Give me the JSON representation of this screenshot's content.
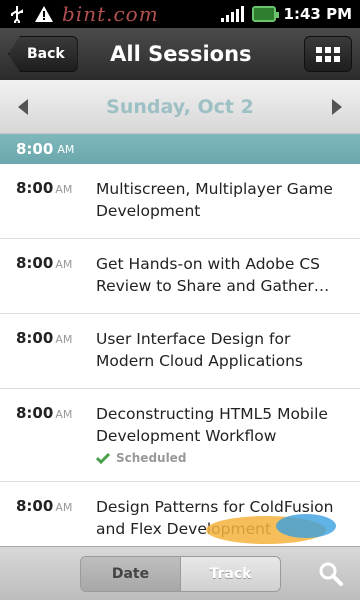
{
  "status_bar": {
    "watermark": "bint.com",
    "time": "1:43 PM",
    "icons": [
      "usb-icon",
      "warning-icon",
      "signal-icon",
      "battery-icon"
    ]
  },
  "header": {
    "back_label": "Back",
    "title": "All Sessions",
    "menu_icon": "grid-icon"
  },
  "date_nav": {
    "date": "Sunday, Oct 2",
    "prev_icon": "chevron-left-icon",
    "next_icon": "chevron-right-icon"
  },
  "section": {
    "time": "8:00",
    "ampm": "AM"
  },
  "sessions": [
    {
      "time": "8:00",
      "ampm": "AM",
      "title": "Multiscreen, Multiplayer Game Development",
      "status": ""
    },
    {
      "time": "8:00",
      "ampm": "AM",
      "title": "Get Hands-on with Adobe CS Review to Share and Gather…",
      "status": ""
    },
    {
      "time": "8:00",
      "ampm": "AM",
      "title": "User Interface Design for Modern Cloud Applications",
      "status": ""
    },
    {
      "time": "8:00",
      "ampm": "AM",
      "title": "Deconstructing HTML5 Mobile Development Workflow",
      "status": "Scheduled"
    },
    {
      "time": "8:00",
      "ampm": "AM",
      "title": "Design Patterns for ColdFusion and Flex Development",
      "status": ""
    }
  ],
  "bottom_bar": {
    "tabs": [
      "Date",
      "Track"
    ],
    "selected": "Date",
    "search_icon": "search-icon"
  },
  "colors": {
    "accent": "#72adb1",
    "date_text": "#9cc0c4",
    "check": "#4aa04a"
  }
}
